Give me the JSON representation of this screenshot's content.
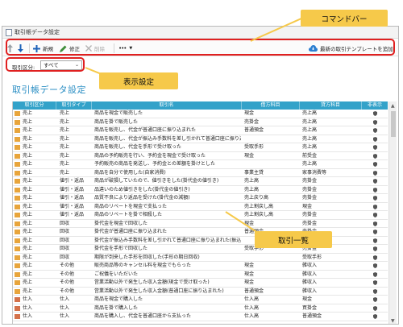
{
  "window": {
    "title": "取引帳データ設定"
  },
  "toolbar": {
    "up_label": "",
    "down_label": "",
    "new_label": "新規",
    "edit_label": "修正",
    "delete_label": "削除",
    "more_label": "•••",
    "cloud_label": "最新の取引テンプレートを追加"
  },
  "filter": {
    "label": "取引区分:",
    "value": "すべて"
  },
  "page_title": "取引帳データ設定",
  "columns": [
    "取引区分",
    "取引タイプ",
    "取引名",
    "借方科目",
    "貸方科目",
    "非表示"
  ],
  "rows": [
    {
      "kind": "売上",
      "type": "売上",
      "name": "商品を現金で販売した",
      "debit": "現金",
      "credit": "売上高",
      "icon": "sell"
    },
    {
      "kind": "売上",
      "type": "売上",
      "name": "商品を掛で販売した",
      "debit": "売掛金",
      "credit": "売上高",
      "icon": "sell"
    },
    {
      "kind": "売上",
      "type": "売上",
      "name": "商品を販売し、代金が普通口座に振り込まれた",
      "debit": "普通預金",
      "credit": "売上高",
      "icon": "sell"
    },
    {
      "kind": "売上",
      "type": "売上",
      "name": "商品を販売し、代金が振込み手数料を差し引かれて普通口座に振り込まれた",
      "debit": "",
      "credit": "売上高",
      "icon": "sell"
    },
    {
      "kind": "売上",
      "type": "売上",
      "name": "商品を販売し、代金を手形で受け取った",
      "debit": "受取手形",
      "credit": "売上高",
      "icon": "sell"
    },
    {
      "kind": "売上",
      "type": "売上",
      "name": "商品の予約販売を行い、予約金を現金で受け取った",
      "debit": "現金",
      "credit": "前受金",
      "icon": "sell"
    },
    {
      "kind": "売上",
      "type": "売上",
      "name": "予約販売の商品を発送し、予約金との差額を掛けとした",
      "debit": "",
      "credit": "売上高",
      "icon": "sell"
    },
    {
      "kind": "売上",
      "type": "売上",
      "name": "商品を自分で使用した(自家消費)",
      "debit": "事業主貸",
      "credit": "家事消費等",
      "icon": "sell"
    },
    {
      "kind": "売上",
      "type": "値引・返品",
      "name": "商品が破損していたので、値引きをした(掛代金の値引き)",
      "debit": "売上高",
      "credit": "売掛金",
      "icon": "sell"
    },
    {
      "kind": "売上",
      "type": "値引・返品",
      "name": "品違いのため値引きをした(掛代金の値引き)",
      "debit": "売上高",
      "credit": "売掛金",
      "icon": "sell"
    },
    {
      "kind": "売上",
      "type": "値引・返品",
      "name": "品質不良により返品を受けた(掛代金の減額)",
      "debit": "売上戻り高",
      "credit": "売掛金",
      "icon": "sell"
    },
    {
      "kind": "売上",
      "type": "値引・返品",
      "name": "商品のリベートを現金で支払った",
      "debit": "売上割戻し高",
      "credit": "現金",
      "icon": "sell"
    },
    {
      "kind": "売上",
      "type": "値引・返品",
      "name": "商品のリベートを掛で相殺した",
      "debit": "売上割戻し高",
      "credit": "売掛金",
      "icon": "sell"
    },
    {
      "kind": "売上",
      "type": "回収",
      "name": "掛代金を現金で回収した",
      "debit": "現金",
      "credit": "売掛金",
      "icon": "sell"
    },
    {
      "kind": "売上",
      "type": "回収",
      "name": "掛代金が普通口座に振り込まれた",
      "debit": "普通預金",
      "credit": "売掛金",
      "icon": "sell"
    },
    {
      "kind": "売上",
      "type": "回収",
      "name": "掛代金が振込み手数料を差し引かれて普通口座に振り込まれた(振込手数料",
      "debit": "",
      "credit": "売掛金",
      "icon": "sell"
    },
    {
      "kind": "売上",
      "type": "回収",
      "name": "掛代金を手形で回収した",
      "debit": "受取手形",
      "credit": "売掛金",
      "icon": "sell"
    },
    {
      "kind": "売上",
      "type": "回収",
      "name": "期限が到来した手形を回収した(手形の期日回収)",
      "debit": "",
      "credit": "受取手形",
      "icon": "sell"
    },
    {
      "kind": "売上",
      "type": "その他",
      "name": "販売商品等のキャンセル料を現金でもらった",
      "debit": "現金",
      "credit": "雑収入",
      "icon": "sell"
    },
    {
      "kind": "売上",
      "type": "その他",
      "name": "ご祝儀をいただいた",
      "debit": "現金",
      "credit": "雑収入",
      "icon": "sell"
    },
    {
      "kind": "売上",
      "type": "その他",
      "name": "営業活動以外で発生した収入金額(現金で受け取った)",
      "debit": "現金",
      "credit": "雑収入",
      "icon": "sell"
    },
    {
      "kind": "売上",
      "type": "その他",
      "name": "営業活動以外で発生した収入金額(普通口座に振り込まれた)",
      "debit": "普通預金",
      "credit": "雑収入",
      "icon": "sell"
    },
    {
      "kind": "仕入",
      "type": "仕入",
      "name": "商品を現金で購入した",
      "debit": "仕入高",
      "credit": "現金",
      "icon": "buy"
    },
    {
      "kind": "仕入",
      "type": "仕入",
      "name": "商品を掛で購入した",
      "debit": "仕入高",
      "credit": "買掛金",
      "icon": "buy"
    },
    {
      "kind": "仕入",
      "type": "仕入",
      "name": "商品を購入し、代金を普通口座から支払った",
      "debit": "仕入高",
      "credit": "普通預金",
      "icon": "buy"
    }
  ],
  "callouts": {
    "command_bar": "コマンドバー",
    "display_settings": "表示設定",
    "transaction_list": "取引一覧"
  },
  "colors": {
    "accent": "#33a2c9",
    "callout": "#f6c94a",
    "highlight": "#e02020"
  }
}
